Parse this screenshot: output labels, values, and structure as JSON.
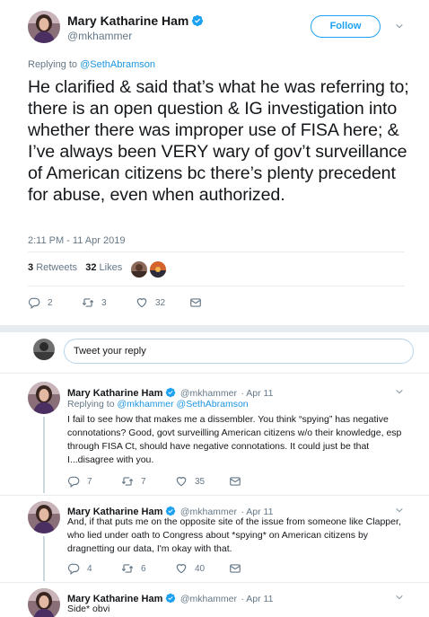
{
  "main": {
    "name": "Mary Katharine Ham",
    "handle": "@mkhammer",
    "follow_label": "Follow",
    "replying_prefix": "Replying to",
    "replying_to": "@SethAbramson",
    "body": "He clarified & said that’s what he was referring to; there is an open question & IG investigation into whether there was improper use of FISA here; & I’ve always been VERY wary of gov’t surveillance of American citizens bc there’s plenty precedent for abuse, even when authorized.",
    "timestamp": "2:11 PM - 11 Apr 2019",
    "retweets_count": "3",
    "retweets_label": "Retweets",
    "likes_count": "32",
    "likes_label": "Likes",
    "actions": {
      "replies": "2",
      "retweets": "3",
      "likes": "32"
    }
  },
  "compose": {
    "placeholder": "Tweet your reply"
  },
  "replies": [
    {
      "name": "Mary Katharine Ham",
      "handle": "@mkhammer",
      "date": "· Apr 11",
      "replying_prefix": "Replying to",
      "replying_to": "@mkhammer @SethAbramson",
      "body": "I fail to see how that makes me a dissembler. You think “spying” has negative connotations? Good, govt surveilling American citizens w/o their knowledge, esp through FISA Ct, should have negative connotations. It could just be that I...disagree with you.",
      "replies": "7",
      "retweets": "7",
      "likes": "35"
    },
    {
      "name": "Mary Katharine Ham",
      "handle": "@mkhammer",
      "date": "· Apr 11",
      "body": "And, if that puts me on the opposite site of the issue from someone like Clapper, who lied under oath to Congress about *spying* on American citizens by dragnetting our data, I'm okay with that.",
      "replies": "4",
      "retweets": "6",
      "likes": "40"
    },
    {
      "name": "Mary Katharine Ham",
      "handle": "@mkhammer",
      "date": "· Apr 11",
      "body": "Side* obvi"
    }
  ],
  "colors": {
    "accent": "#1da1f2",
    "muted": "#657786",
    "link": "#1b95e0",
    "divider": "#e6ecf0"
  }
}
